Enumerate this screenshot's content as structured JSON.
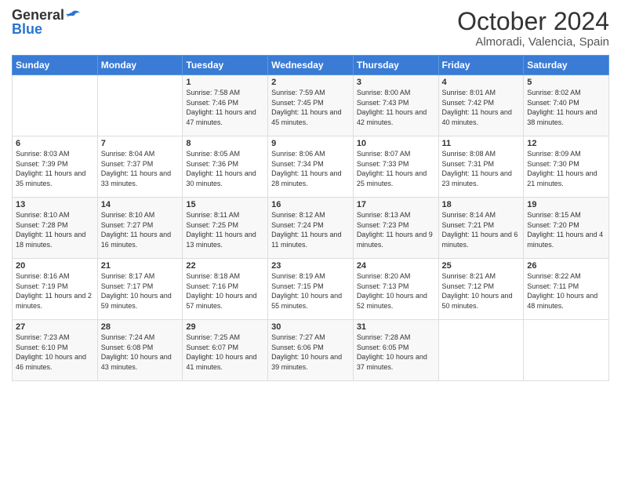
{
  "logo": {
    "general": "General",
    "blue": "Blue"
  },
  "title": "October 2024",
  "location": "Almoradi, Valencia, Spain",
  "days_header": [
    "Sunday",
    "Monday",
    "Tuesday",
    "Wednesday",
    "Thursday",
    "Friday",
    "Saturday"
  ],
  "weeks": [
    [
      {
        "num": "",
        "info": ""
      },
      {
        "num": "",
        "info": ""
      },
      {
        "num": "1",
        "info": "Sunrise: 7:58 AM\nSunset: 7:46 PM\nDaylight: 11 hours and 47 minutes."
      },
      {
        "num": "2",
        "info": "Sunrise: 7:59 AM\nSunset: 7:45 PM\nDaylight: 11 hours and 45 minutes."
      },
      {
        "num": "3",
        "info": "Sunrise: 8:00 AM\nSunset: 7:43 PM\nDaylight: 11 hours and 42 minutes."
      },
      {
        "num": "4",
        "info": "Sunrise: 8:01 AM\nSunset: 7:42 PM\nDaylight: 11 hours and 40 minutes."
      },
      {
        "num": "5",
        "info": "Sunrise: 8:02 AM\nSunset: 7:40 PM\nDaylight: 11 hours and 38 minutes."
      }
    ],
    [
      {
        "num": "6",
        "info": "Sunrise: 8:03 AM\nSunset: 7:39 PM\nDaylight: 11 hours and 35 minutes."
      },
      {
        "num": "7",
        "info": "Sunrise: 8:04 AM\nSunset: 7:37 PM\nDaylight: 11 hours and 33 minutes."
      },
      {
        "num": "8",
        "info": "Sunrise: 8:05 AM\nSunset: 7:36 PM\nDaylight: 11 hours and 30 minutes."
      },
      {
        "num": "9",
        "info": "Sunrise: 8:06 AM\nSunset: 7:34 PM\nDaylight: 11 hours and 28 minutes."
      },
      {
        "num": "10",
        "info": "Sunrise: 8:07 AM\nSunset: 7:33 PM\nDaylight: 11 hours and 25 minutes."
      },
      {
        "num": "11",
        "info": "Sunrise: 8:08 AM\nSunset: 7:31 PM\nDaylight: 11 hours and 23 minutes."
      },
      {
        "num": "12",
        "info": "Sunrise: 8:09 AM\nSunset: 7:30 PM\nDaylight: 11 hours and 21 minutes."
      }
    ],
    [
      {
        "num": "13",
        "info": "Sunrise: 8:10 AM\nSunset: 7:28 PM\nDaylight: 11 hours and 18 minutes."
      },
      {
        "num": "14",
        "info": "Sunrise: 8:10 AM\nSunset: 7:27 PM\nDaylight: 11 hours and 16 minutes."
      },
      {
        "num": "15",
        "info": "Sunrise: 8:11 AM\nSunset: 7:25 PM\nDaylight: 11 hours and 13 minutes."
      },
      {
        "num": "16",
        "info": "Sunrise: 8:12 AM\nSunset: 7:24 PM\nDaylight: 11 hours and 11 minutes."
      },
      {
        "num": "17",
        "info": "Sunrise: 8:13 AM\nSunset: 7:23 PM\nDaylight: 11 hours and 9 minutes."
      },
      {
        "num": "18",
        "info": "Sunrise: 8:14 AM\nSunset: 7:21 PM\nDaylight: 11 hours and 6 minutes."
      },
      {
        "num": "19",
        "info": "Sunrise: 8:15 AM\nSunset: 7:20 PM\nDaylight: 11 hours and 4 minutes."
      }
    ],
    [
      {
        "num": "20",
        "info": "Sunrise: 8:16 AM\nSunset: 7:19 PM\nDaylight: 11 hours and 2 minutes."
      },
      {
        "num": "21",
        "info": "Sunrise: 8:17 AM\nSunset: 7:17 PM\nDaylight: 10 hours and 59 minutes."
      },
      {
        "num": "22",
        "info": "Sunrise: 8:18 AM\nSunset: 7:16 PM\nDaylight: 10 hours and 57 minutes."
      },
      {
        "num": "23",
        "info": "Sunrise: 8:19 AM\nSunset: 7:15 PM\nDaylight: 10 hours and 55 minutes."
      },
      {
        "num": "24",
        "info": "Sunrise: 8:20 AM\nSunset: 7:13 PM\nDaylight: 10 hours and 52 minutes."
      },
      {
        "num": "25",
        "info": "Sunrise: 8:21 AM\nSunset: 7:12 PM\nDaylight: 10 hours and 50 minutes."
      },
      {
        "num": "26",
        "info": "Sunrise: 8:22 AM\nSunset: 7:11 PM\nDaylight: 10 hours and 48 minutes."
      }
    ],
    [
      {
        "num": "27",
        "info": "Sunrise: 7:23 AM\nSunset: 6:10 PM\nDaylight: 10 hours and 46 minutes."
      },
      {
        "num": "28",
        "info": "Sunrise: 7:24 AM\nSunset: 6:08 PM\nDaylight: 10 hours and 43 minutes."
      },
      {
        "num": "29",
        "info": "Sunrise: 7:25 AM\nSunset: 6:07 PM\nDaylight: 10 hours and 41 minutes."
      },
      {
        "num": "30",
        "info": "Sunrise: 7:27 AM\nSunset: 6:06 PM\nDaylight: 10 hours and 39 minutes."
      },
      {
        "num": "31",
        "info": "Sunrise: 7:28 AM\nSunset: 6:05 PM\nDaylight: 10 hours and 37 minutes."
      },
      {
        "num": "",
        "info": ""
      },
      {
        "num": "",
        "info": ""
      }
    ]
  ]
}
